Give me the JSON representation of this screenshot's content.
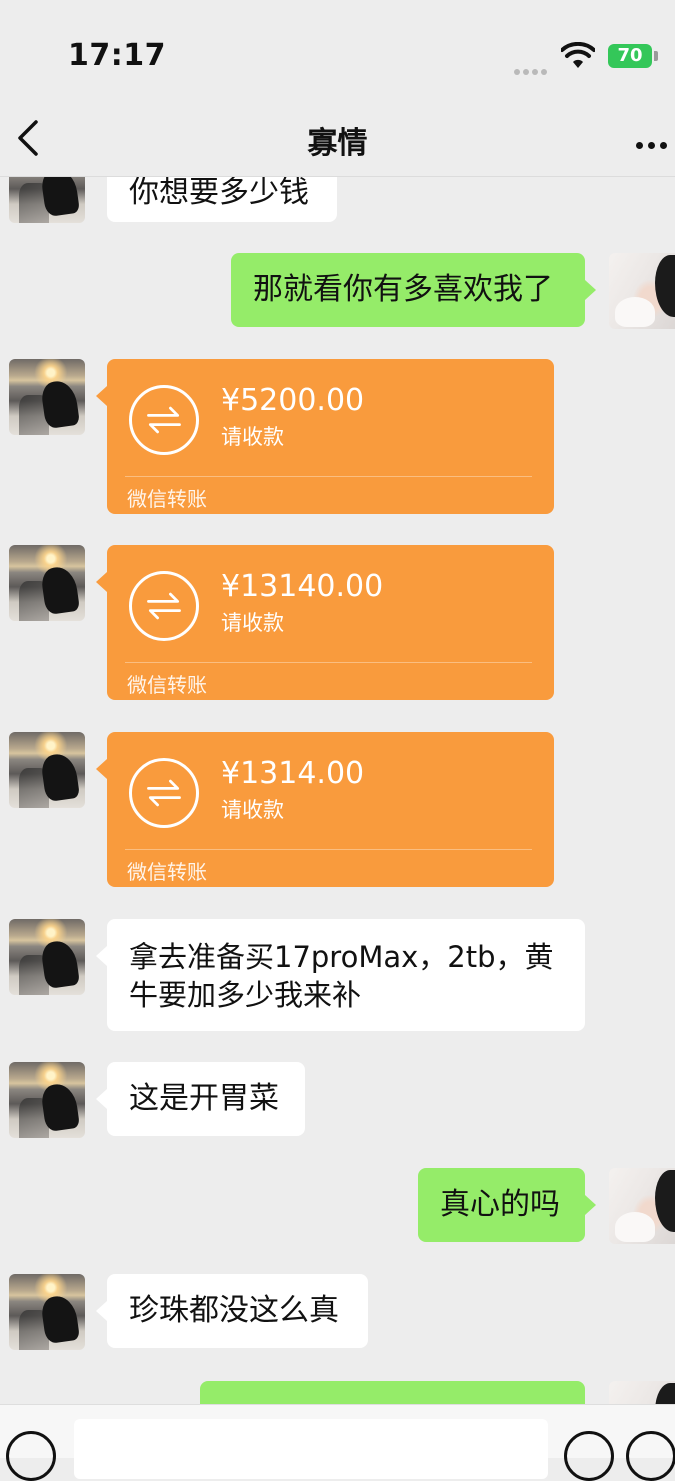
{
  "status_bar": {
    "time": "17:17",
    "battery": "70"
  },
  "header": {
    "title": "寡情"
  },
  "messages": [
    {
      "side": "left",
      "type": "text",
      "text": "你想要多少钱"
    },
    {
      "side": "right",
      "type": "text",
      "text": "那就看你有多喜欢我了"
    },
    {
      "side": "left",
      "type": "transfer",
      "amount": "¥5200.00",
      "status": "请收款",
      "label": "微信转账"
    },
    {
      "side": "left",
      "type": "transfer",
      "amount": "¥13140.00",
      "status": "请收款",
      "label": "微信转账"
    },
    {
      "side": "left",
      "type": "transfer",
      "amount": "¥1314.00",
      "status": "请收款",
      "label": "微信转账"
    },
    {
      "side": "left",
      "type": "text",
      "lines": [
        "拿去准备买17proMax，2tb，黄",
        "牛要加多少我来补"
      ]
    },
    {
      "side": "left",
      "type": "text",
      "text": "这是开胃菜"
    },
    {
      "side": "right",
      "type": "text",
      "text": "真心的吗"
    },
    {
      "side": "left",
      "type": "text",
      "text": "珍珠都没这么真"
    },
    {
      "side": "right",
      "type": "text",
      "text": ""
    }
  ],
  "colors": {
    "background": "#ededed",
    "sent_bubble": "#95ec69",
    "received_bubble": "#ffffff",
    "transfer": "#f99b3d"
  },
  "icons": [
    "back-icon",
    "more-icon",
    "transfer-icon",
    "voice-icon",
    "emoji-icon",
    "plus-icon",
    "wifi-icon"
  ]
}
